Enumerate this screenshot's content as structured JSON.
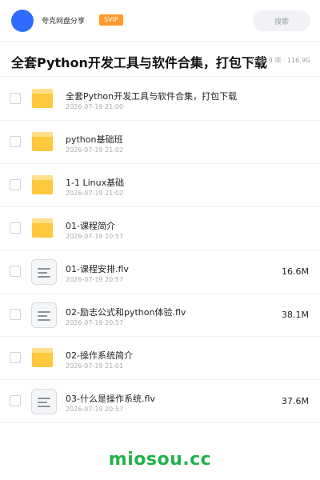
{
  "header": {
    "app_name": "夸克网盘分享",
    "badge": "SVIP",
    "search_placeholder": "搜索"
  },
  "folder": {
    "title": "全套Python开发工具与软件合集，打包下载",
    "meta": "共 2819 项 · 116.9G"
  },
  "items": [
    {
      "type": "folder",
      "name": "全套Python开发工具与软件合集，打包下载",
      "time": "2026-07-19 21:00",
      "size": ""
    },
    {
      "type": "folder",
      "name": "python基础班",
      "time": "2026-07-19 21:02",
      "size": ""
    },
    {
      "type": "folder",
      "name": "1-1 Linux基础",
      "time": "2026-07-19 21:02",
      "size": ""
    },
    {
      "type": "folder",
      "name": "01-课程简介",
      "time": "2026-07-19 20:57",
      "size": ""
    },
    {
      "type": "file",
      "name": "01-课程安排.flv",
      "time": "2026-07-19 20:57",
      "size": "16.6M"
    },
    {
      "type": "file",
      "name": "02-励志公式和python体验.flv",
      "time": "2026-07-19 20:57",
      "size": "38.1M"
    },
    {
      "type": "folder",
      "name": "02-操作系统简介",
      "time": "2026-07-19 21:01",
      "size": ""
    },
    {
      "type": "file",
      "name": "03-什么是操作系统.flv",
      "time": "2026-07-19 20:57",
      "size": "37.6M"
    }
  ],
  "watermark": "miosou.cc",
  "colors": {
    "accent": "#2f6bff",
    "badge": "#ff9a2a",
    "folder": "#ffc83d",
    "watermark": "#22b14c"
  }
}
